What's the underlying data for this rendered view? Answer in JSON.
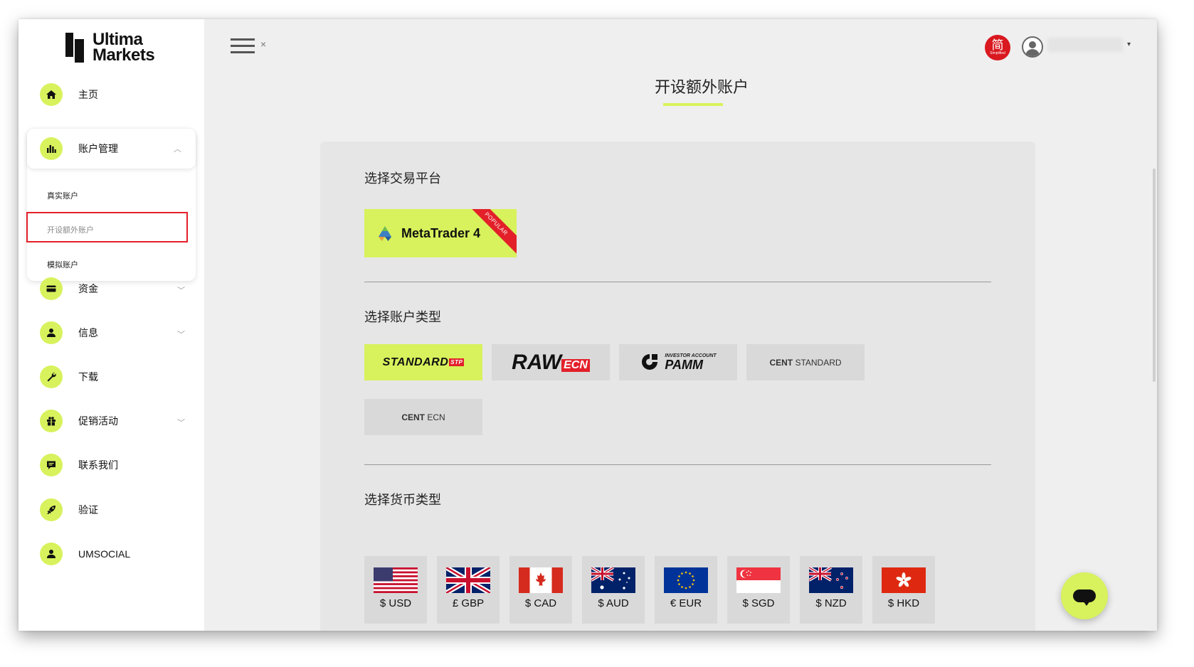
{
  "brand": {
    "line1": "Ultima",
    "line2": "Markets"
  },
  "sidebar": {
    "items": [
      {
        "label": "主页",
        "icon": "home-icon"
      },
      {
        "label": "账户管理",
        "icon": "bar-chart-icon",
        "expanded": true,
        "sub_items": [
          {
            "label": "真实账户"
          },
          {
            "label": "开设额外账户",
            "active": true
          },
          {
            "label": "模拟账户"
          }
        ]
      },
      {
        "label": "资金",
        "icon": "wallet-icon"
      },
      {
        "label": "信息",
        "icon": "user-icon"
      },
      {
        "label": "下载",
        "icon": "wrench-icon"
      },
      {
        "label": "促销活动",
        "icon": "gift-icon"
      },
      {
        "label": "联系我们",
        "icon": "message-icon"
      },
      {
        "label": "验证",
        "icon": "rocket-icon"
      },
      {
        "label": "UMSOCIAL",
        "icon": "user-icon"
      }
    ]
  },
  "header": {
    "close_glyph": "×",
    "lang_badge": {
      "char": "简",
      "sub": "Simplified"
    },
    "user_caret": "▾"
  },
  "page": {
    "title": "开设额外账户"
  },
  "sections": {
    "platform": {
      "title": "选择交易平台",
      "option": {
        "label": "MetaTrader 4",
        "ribbon": "POPULAR",
        "selected": true
      }
    },
    "account_type": {
      "title": "选择账户类型",
      "options": [
        {
          "main": "STANDARD",
          "tag": "STP",
          "selected": true
        },
        {
          "main": "RAW",
          "tag": "ECN",
          "selected": false
        },
        {
          "small": "INVESTOR ACCOUNT",
          "main": "PAMM",
          "selected": false
        },
        {
          "bold": "CENT",
          "rest": " STANDARD",
          "selected": false
        },
        {
          "bold": "CENT",
          "rest": " ECN",
          "selected": false
        }
      ]
    },
    "currency": {
      "title": "选择货币类型",
      "options": [
        {
          "label": "$ USD",
          "flag": "us-flag-icon"
        },
        {
          "label": "£ GBP",
          "flag": "uk-flag-icon"
        },
        {
          "label": "$ CAD",
          "flag": "ca-flag-icon"
        },
        {
          "label": "$ AUD",
          "flag": "au-flag-icon"
        },
        {
          "label": "€ EUR",
          "flag": "eu-flag-icon"
        },
        {
          "label": "$ SGD",
          "flag": "sg-flag-icon"
        },
        {
          "label": "$ NZD",
          "flag": "nz-flag-icon"
        },
        {
          "label": "$ HKD",
          "flag": "hk-flag-icon"
        }
      ]
    }
  },
  "colors": {
    "accent": "#d7f25c",
    "highlight": "#e3202a",
    "card": "#e6e6e6",
    "background": "#efefef"
  }
}
